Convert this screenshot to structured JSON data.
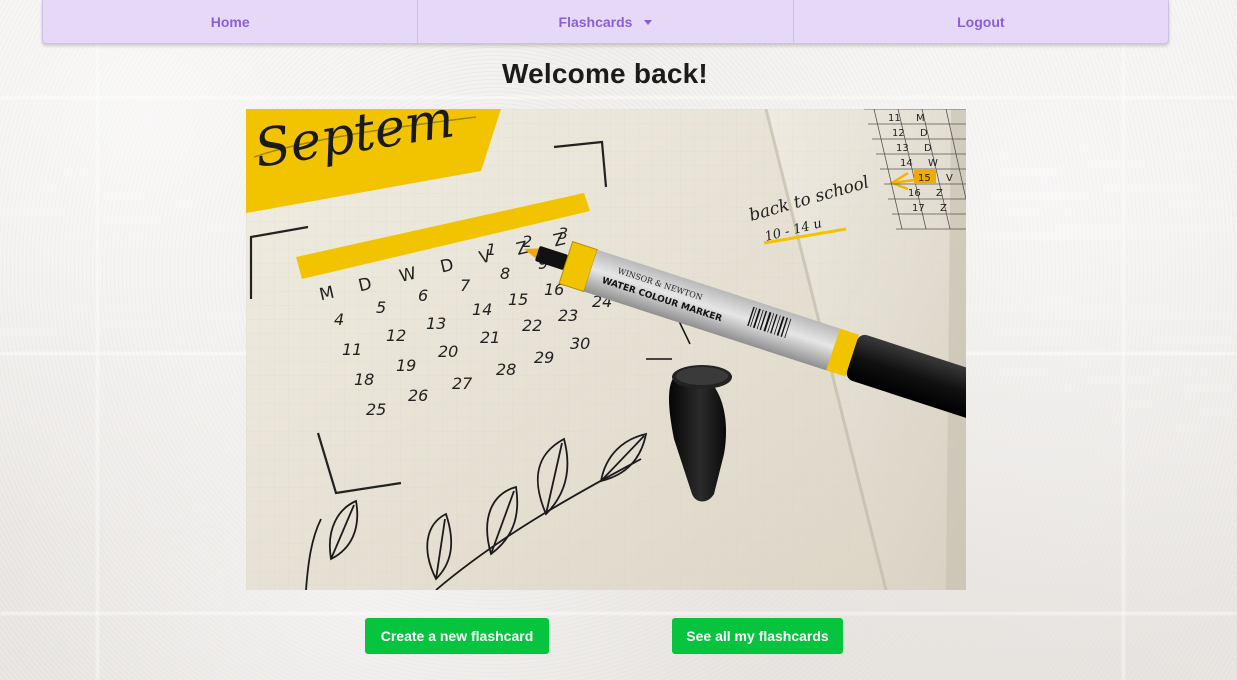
{
  "navbar": {
    "home_label": "Home",
    "flashcards_label": "Flashcards",
    "logout_label": "Logout"
  },
  "page": {
    "title": "Welcome back!"
  },
  "hero": {
    "month_text": "Septem",
    "weekdays": [
      "M",
      "D",
      "W",
      "D",
      "V",
      "Z",
      "Z"
    ],
    "days": [
      "1",
      "2",
      "3",
      "4",
      "5",
      "6",
      "7",
      "8",
      "9",
      "11",
      "12",
      "13",
      "14",
      "15",
      "16",
      "23",
      "24",
      "18",
      "19",
      "20",
      "21",
      "22",
      "25",
      "26",
      "27",
      "28",
      "29",
      "30"
    ],
    "note_text": "back to school",
    "note_dates": "10 - 14 u",
    "marker_brand": "WINSOR & NEWTON",
    "marker_label": "WATER COLOUR MARKER",
    "side_numbers": [
      "11",
      "12",
      "13",
      "14",
      "15",
      "16",
      "17"
    ],
    "side_letters": [
      "M",
      "D",
      "D",
      "W",
      "V",
      "Z",
      "Z"
    ]
  },
  "actions": {
    "create_label": "Create a new flashcard",
    "see_all_label": "See all my flashcards"
  },
  "colors": {
    "nav_bg": "#e5d9f7",
    "nav_text": "#8a5fd6",
    "button_bg": "#07c43e",
    "marker_yellow": "#f2c400"
  }
}
